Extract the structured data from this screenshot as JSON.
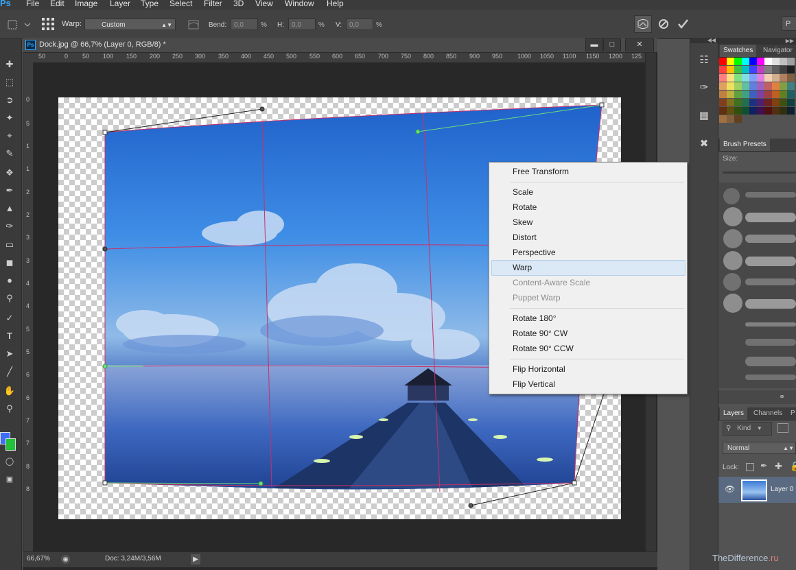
{
  "menubar": {
    "logo": "Ps",
    "items": [
      "File",
      "Edit",
      "Image",
      "Layer",
      "Type",
      "Select",
      "Filter",
      "3D",
      "View",
      "Window",
      "Help"
    ]
  },
  "options": {
    "warp_label": "Warp:",
    "warp_value": "Custom",
    "bend_label": "Bend:",
    "bend_value": "0,0",
    "h_label": "H:",
    "h_value": "0,0",
    "v_label": "V:",
    "v_value": "0,0",
    "pct": "%",
    "right_cut": "P"
  },
  "document": {
    "title": "Dock.jpg @ 66,7% (Layer 0, RGB/8) *",
    "zoom": "66,67%",
    "doc_size": "Doc: 3,24M/3,56M",
    "ruler_h": [
      "50",
      "0",
      "50",
      "100",
      "150",
      "200",
      "250",
      "300",
      "350",
      "400",
      "450",
      "500",
      "550",
      "600",
      "650",
      "700",
      "750",
      "800",
      "850",
      "900",
      "950",
      "1000",
      "1050",
      "1100",
      "1150",
      "1200",
      "125"
    ],
    "ruler_v": [
      "0",
      "5",
      "1",
      "1",
      "2",
      "2",
      "3",
      "3",
      "4",
      "4",
      "5",
      "5",
      "6",
      "6",
      "7",
      "7",
      "8",
      "8"
    ]
  },
  "context_menu": {
    "items": [
      {
        "label": "Free Transform",
        "enabled": true
      },
      {
        "label": "Scale",
        "enabled": true
      },
      {
        "label": "Rotate",
        "enabled": true
      },
      {
        "label": "Skew",
        "enabled": true
      },
      {
        "label": "Distort",
        "enabled": true
      },
      {
        "label": "Perspective",
        "enabled": true
      },
      {
        "label": "Warp",
        "enabled": true,
        "highlighted": true
      },
      {
        "label": "Content-Aware Scale",
        "enabled": false
      },
      {
        "label": "Puppet Warp",
        "enabled": false
      },
      {
        "label": "Rotate 180°",
        "enabled": true
      },
      {
        "label": "Rotate 90° CW",
        "enabled": true
      },
      {
        "label": "Rotate 90° CCW",
        "enabled": true
      },
      {
        "label": "Flip Horizontal",
        "enabled": true
      },
      {
        "label": "Flip Vertical",
        "enabled": true
      }
    ]
  },
  "panels": {
    "swatches_tab": "Swatches",
    "navigator_tab": "Navigator",
    "brush_presets_tab": "Brush Presets",
    "size_label": "Size:",
    "layers_tab": "Layers",
    "channels_tab": "Channels",
    "paths_tab_cut": "P",
    "kind_label": "Kind",
    "blend_mode": "Normal",
    "lock_label": "Lock:",
    "layer_name": "Layer 0"
  },
  "watermark": {
    "brand": "TheDifference",
    "tld": ".ru"
  },
  "colors": {
    "foreground": "#3d6ef5",
    "background": "#22c33a",
    "accent": "#31a8ff",
    "warp_grid": "#c8306a",
    "warp_handle_line": "#6be07a"
  },
  "icons": [
    "move-icon",
    "marquee-icon",
    "lasso-icon",
    "magic-wand-icon",
    "crop-icon",
    "eyedropper-icon",
    "healing-icon",
    "brush-icon",
    "stamp-icon",
    "history-brush-icon",
    "eraser-icon",
    "bucket-icon",
    "blur-icon",
    "dodge-icon",
    "pen-icon",
    "type-icon",
    "path-select-icon",
    "line-icon",
    "hand-icon",
    "zoom-icon",
    "cancel-icon",
    "commit-icon",
    "warp-mode-icon"
  ]
}
